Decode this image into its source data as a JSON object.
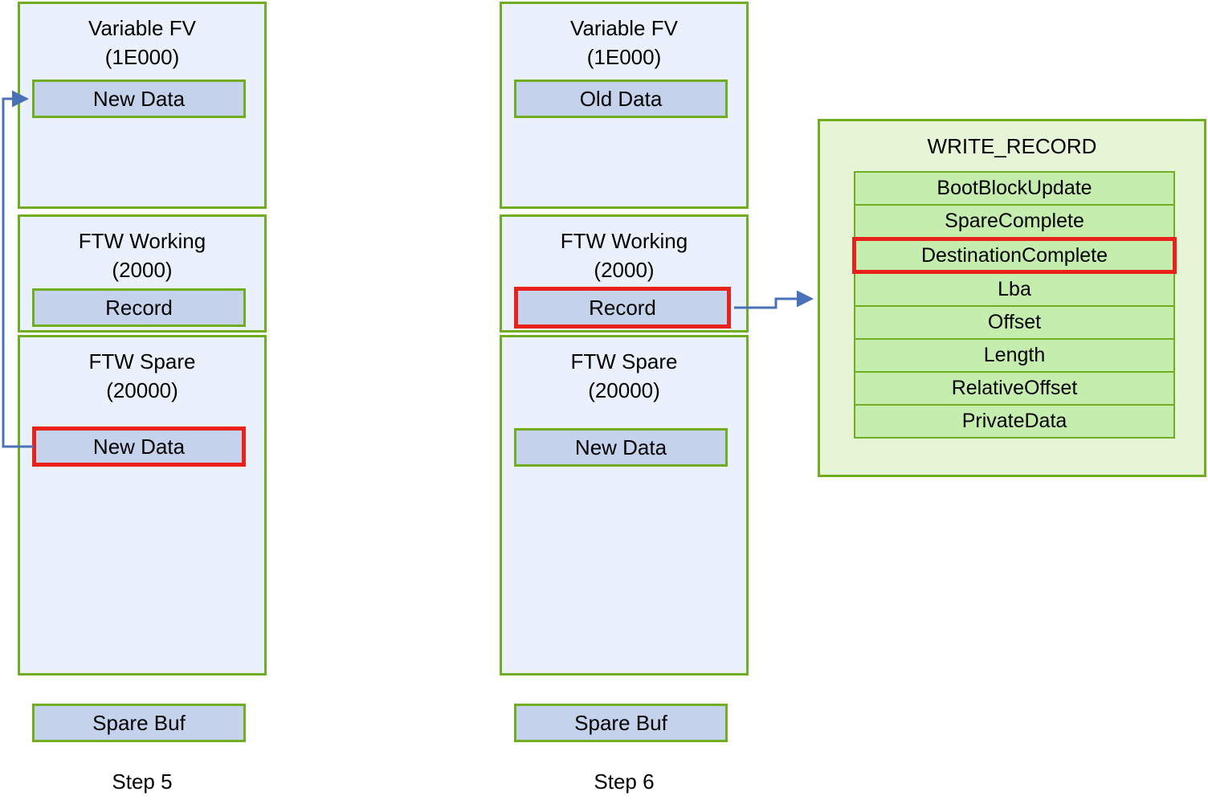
{
  "diagram": {
    "title": "FTW write record state diagram",
    "colors": {
      "region_border": "#70AD22",
      "region_fill": "#EAF1FC",
      "data_fill": "#C5D2EC",
      "highlight": "#E8221A",
      "panel_fill": "#E6F5D5",
      "row_fill": "#C5EDAE",
      "arrow": "#4A71B8"
    }
  },
  "step5": {
    "caption": "Step 5",
    "regions": [
      {
        "title": "Variable FV\n(1E000)",
        "block": "New Data",
        "highlighted": false
      },
      {
        "title": "FTW Working\n(2000)",
        "block": "Record",
        "highlighted": false
      },
      {
        "title": "FTW Spare\n(20000)",
        "block": "New Data",
        "highlighted": true
      }
    ],
    "spare_buf": "Spare Buf"
  },
  "step6": {
    "caption": "Step 6",
    "regions": [
      {
        "title": "Variable FV\n(1E000)",
        "block": "Old Data",
        "highlighted": false
      },
      {
        "title": "FTW Working\n(2000)",
        "block": "Record",
        "highlighted": true
      },
      {
        "title": "FTW Spare\n(20000)",
        "block": "New Data",
        "highlighted": false
      }
    ],
    "spare_buf": "Spare Buf"
  },
  "write_record": {
    "title": "WRITE_RECORD",
    "fields": [
      {
        "label": "BootBlockUpdate",
        "highlighted": false
      },
      {
        "label": "SpareComplete",
        "highlighted": false
      },
      {
        "label": "DestinationComplete",
        "highlighted": true
      },
      {
        "label": "Lba",
        "highlighted": false
      },
      {
        "label": "Offset",
        "highlighted": false
      },
      {
        "label": "Length",
        "highlighted": false
      },
      {
        "label": "RelativeOffset",
        "highlighted": false
      },
      {
        "label": "PrivateData",
        "highlighted": false
      }
    ]
  }
}
